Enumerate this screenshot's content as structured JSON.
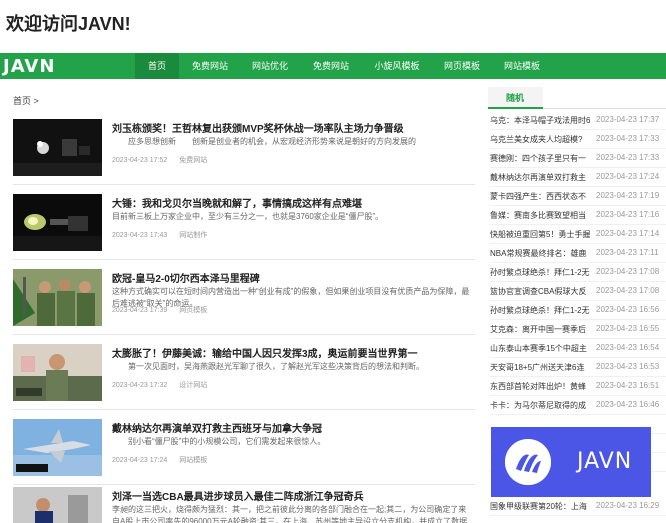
{
  "header": {
    "welcome": "欢迎访问JAVN!"
  },
  "nav": {
    "logo": "JAVN",
    "items": [
      "首页",
      "免费网站",
      "网站优化",
      "免费网站",
      "小旋风模板",
      "网页模板",
      "网站模板"
    ],
    "active_index": 0,
    "colors": {
      "bar": "#22a34a",
      "active": "#1a8a3c"
    }
  },
  "breadcrumb": "首页 >",
  "articles": [
    {
      "title": "刘玉栋颁奖！王哲林复出获颁MVP奖杯休战一场率队主场力争晋级",
      "desc": "　　应多思想创新　　创新是创业者的机会，从宏观经济形势来说是朝好的方向发展的",
      "date": "2023-04-23 17:52",
      "category": "免费网站"
    },
    {
      "title": "大锤：我和戈贝尔当晚就和解了，事情搞成这样有点难堪",
      "desc": "目前新三板上万家企业中，至少有三分之一，也就是3760家企业是“僵尸股”。",
      "date": "2023-04-23 17:43",
      "category": "网站制作"
    },
    {
      "title": "欧冠-皇马2-0切尔西本泽马里程碑",
      "desc": "这种方式确实可以在短时间内营造出一种“创业有成”的假象，但如果创业项目没有优质产品为保障，最后难逃被“取关”的命运。",
      "date": "2023-04-23 17:39",
      "category": "网页模板"
    },
    {
      "title": "太膨胀了！伊藤美诚：输给中国人因只发挥3成，奥运前要当世界第一",
      "desc": "　　第一次见面时，吴海燕跟赵光军聊了很久，了解赵光军这些决策背后的想法和判断。",
      "date": "2023-04-23 17:32",
      "category": "设计网站"
    },
    {
      "title": "戴林纳达尔再演单双打救主西班牙与加拿大争冠",
      "desc": "　　别小看“僵尸股”中的小规模公司，它们需发起来很惊人。",
      "date": "2023-04-23 17:24",
      "category": "网站模板"
    },
    {
      "title": "刘泽一当选CBA最具进步球员入最佳二阵成浙江争冠奇兵",
      "desc": "李昶的这三把火，烧得颇为猛烈：其一，把之前彼此分离的各部门融合在一起;其二，为公司确定了来自A股上市公司率先的96000万元A轮融资;其三，在上海、苏州等地主导设立分支机构，并成立了数据",
      "date": "",
      "category": ""
    }
  ],
  "sidebar": {
    "tab_label": "随机",
    "items": [
      {
        "title": "乌克：本泽马帽子戏法用时6",
        "date": "2023-04-23 17:37"
      },
      {
        "title": "乌克兰美女成夹人均超模?",
        "date": "2023-04-23 17:33"
      },
      {
        "title": "赛德刚：四个孩子里只有一",
        "date": "2023-04-23 17:33"
      },
      {
        "title": "戴林纳达尔再演单双打救主",
        "date": "2023-04-23 17:24"
      },
      {
        "title": "蒙卡四强产生：西西状态不",
        "date": "2023-04-23 17:19"
      },
      {
        "title": "鲁媒：赛南多比赛致望相当",
        "date": "2023-04-23 17:16"
      },
      {
        "title": "快船被迫重回第5！勇士手握",
        "date": "2023-04-23 17:14"
      },
      {
        "title": "NBA常规赛最终排名：雄鹿",
        "date": "2023-04-23 17:11"
      },
      {
        "title": "孙时繁点球绝杀！拜仁1-2无",
        "date": "2023-04-23 17:08"
      },
      {
        "title": "篮协官宣调查CBA假球大反",
        "date": "2023-04-23 17:08"
      },
      {
        "title": "孙时繁点球绝杀！拜仁1-2无",
        "date": "2023-04-23 16:56"
      },
      {
        "title": "艾克森：离开中国一赛季后",
        "date": "2023-04-23 16:55"
      },
      {
        "title": "山东泰山本赛季15个中超主",
        "date": "2023-04-23 16:54"
      },
      {
        "title": "天安哥18+5广州送天津6连",
        "date": "2023-04-23 16:53"
      },
      {
        "title": "东西部首轮对阵出炉！黄蜂",
        "date": "2023-04-23 16:51"
      },
      {
        "title": "卡卡：为马尔蒂尼取得的成",
        "date": "2023-04-23 16:46"
      },
      {
        "title": "",
        "date": ""
      },
      {
        "title": "",
        "date": ""
      },
      {
        "title": "",
        "date": ""
      },
      {
        "title": "国象甲级联赛第20轮：上海",
        "date": "2023-04-23 16:29"
      }
    ]
  },
  "overlay": {
    "text": "JAVN",
    "color": "#4b55e6"
  }
}
